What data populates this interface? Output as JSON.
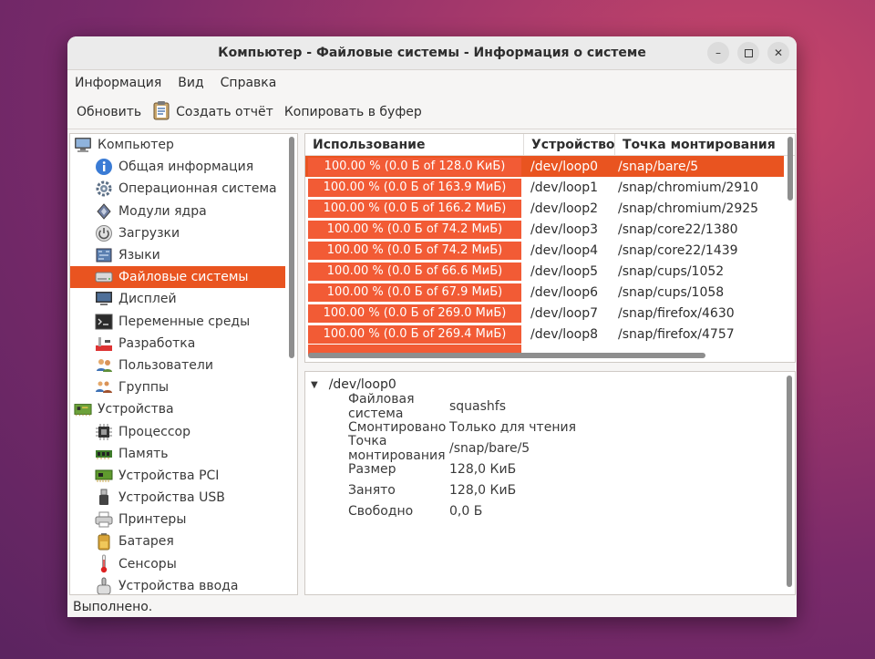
{
  "window": {
    "title": "Компьютер - Файловые системы - Информация о системе"
  },
  "menu": [
    "Информация",
    "Вид",
    "Справка"
  ],
  "toolbar": {
    "refresh": "Обновить",
    "report": "Создать отчёт",
    "copy": "Копировать в буфер"
  },
  "tree": [
    {
      "label": "Компьютер",
      "level": 0,
      "icon": "computer-icon"
    },
    {
      "label": "Общая информация",
      "level": 1,
      "icon": "info-icon"
    },
    {
      "label": "Операционная система",
      "level": 1,
      "icon": "gear-icon"
    },
    {
      "label": "Модули ядра",
      "level": 1,
      "icon": "module-icon"
    },
    {
      "label": "Загрузки",
      "level": 1,
      "icon": "power-icon"
    },
    {
      "label": "Языки",
      "level": 1,
      "icon": "flag-icon"
    },
    {
      "label": "Файловые системы",
      "level": 1,
      "icon": "drive-icon",
      "selected": true
    },
    {
      "label": "Дисплей",
      "level": 1,
      "icon": "monitor-icon"
    },
    {
      "label": "Переменные среды",
      "level": 1,
      "icon": "terminal-icon"
    },
    {
      "label": "Разработка",
      "level": 1,
      "icon": "devel-icon"
    },
    {
      "label": "Пользователи",
      "level": 1,
      "icon": "users-icon"
    },
    {
      "label": "Группы",
      "level": 1,
      "icon": "group-icon"
    },
    {
      "label": "Устройства",
      "level": 0,
      "icon": "board-icon"
    },
    {
      "label": "Процессор",
      "level": 1,
      "icon": "cpu-icon"
    },
    {
      "label": "Память",
      "level": 1,
      "icon": "memory-icon"
    },
    {
      "label": "Устройства PCI",
      "level": 1,
      "icon": "pci-icon"
    },
    {
      "label": "Устройства USB",
      "level": 1,
      "icon": "usb-icon"
    },
    {
      "label": "Принтеры",
      "level": 1,
      "icon": "printer-icon"
    },
    {
      "label": "Батарея",
      "level": 1,
      "icon": "battery-icon"
    },
    {
      "label": "Сенсоры",
      "level": 1,
      "icon": "thermometer-icon"
    },
    {
      "label": "Устройства ввода",
      "level": 1,
      "icon": "keyboard-icon"
    }
  ],
  "table": {
    "headers": [
      "Использование",
      "Устройство",
      "Точка монтирования"
    ],
    "rows": [
      {
        "usage": "100.00 % (0.0 Б of 128.0 КиБ)",
        "device": "/dev/loop0",
        "mount": "/snap/bare/5",
        "selected": true
      },
      {
        "usage": "100.00 % (0.0 Б of 163.9 МиБ)",
        "device": "/dev/loop1",
        "mount": "/snap/chromium/2910"
      },
      {
        "usage": "100.00 % (0.0 Б of 166.2 МиБ)",
        "device": "/dev/loop2",
        "mount": "/snap/chromium/2925"
      },
      {
        "usage": "100.00 % (0.0 Б of 74.2 МиБ)",
        "device": "/dev/loop3",
        "mount": "/snap/core22/1380"
      },
      {
        "usage": "100.00 % (0.0 Б of 74.2 МиБ)",
        "device": "/dev/loop4",
        "mount": "/snap/core22/1439"
      },
      {
        "usage": "100.00 % (0.0 Б of 66.6 МиБ)",
        "device": "/dev/loop5",
        "mount": "/snap/cups/1052"
      },
      {
        "usage": "100.00 % (0.0 Б of 67.9 МиБ)",
        "device": "/dev/loop6",
        "mount": "/snap/cups/1058"
      },
      {
        "usage": "100.00 % (0.0 Б of 269.0 МиБ)",
        "device": "/dev/loop7",
        "mount": "/snap/firefox/4630"
      },
      {
        "usage": "100.00 % (0.0 Б of 269.4 МиБ)",
        "device": "/dev/loop8",
        "mount": "/snap/firefox/4757"
      }
    ]
  },
  "details": {
    "device": "/dev/loop0",
    "rows": [
      {
        "key": "Файловая система",
        "value": "squashfs"
      },
      {
        "key": "Смонтировано",
        "value": "Только для чтения"
      },
      {
        "key": "Точка монтирования",
        "value": "/snap/bare/5"
      },
      {
        "key": "Размер",
        "value": "128,0 КиБ"
      },
      {
        "key": "Занято",
        "value": "128,0 КиБ"
      },
      {
        "key": "Свободно",
        "value": "0,0 Б"
      }
    ]
  },
  "status": "Выполнено.",
  "colors": {
    "accent": "#e95420",
    "usage_bar": "#f25b35"
  }
}
